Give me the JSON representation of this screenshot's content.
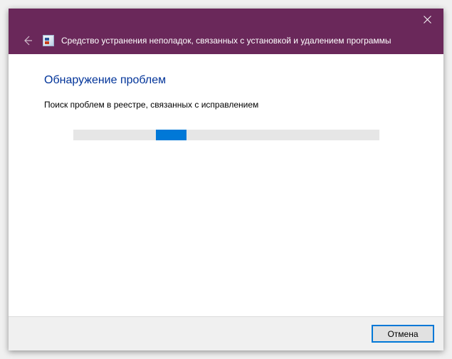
{
  "titlebar": {
    "title": "Средство устранения неполадок, связанных с установкой и удалением программы"
  },
  "main": {
    "heading": "Обнаружение проблем",
    "status": "Поиск проблем в реестре, связанных с исправлением"
  },
  "progress": {
    "left_percent": 27,
    "width_percent": 10
  },
  "footer": {
    "cancel_label": "Отмена"
  },
  "colors": {
    "accent": "#0078d7",
    "titlebar": "#6a285a",
    "heading": "#003399"
  }
}
